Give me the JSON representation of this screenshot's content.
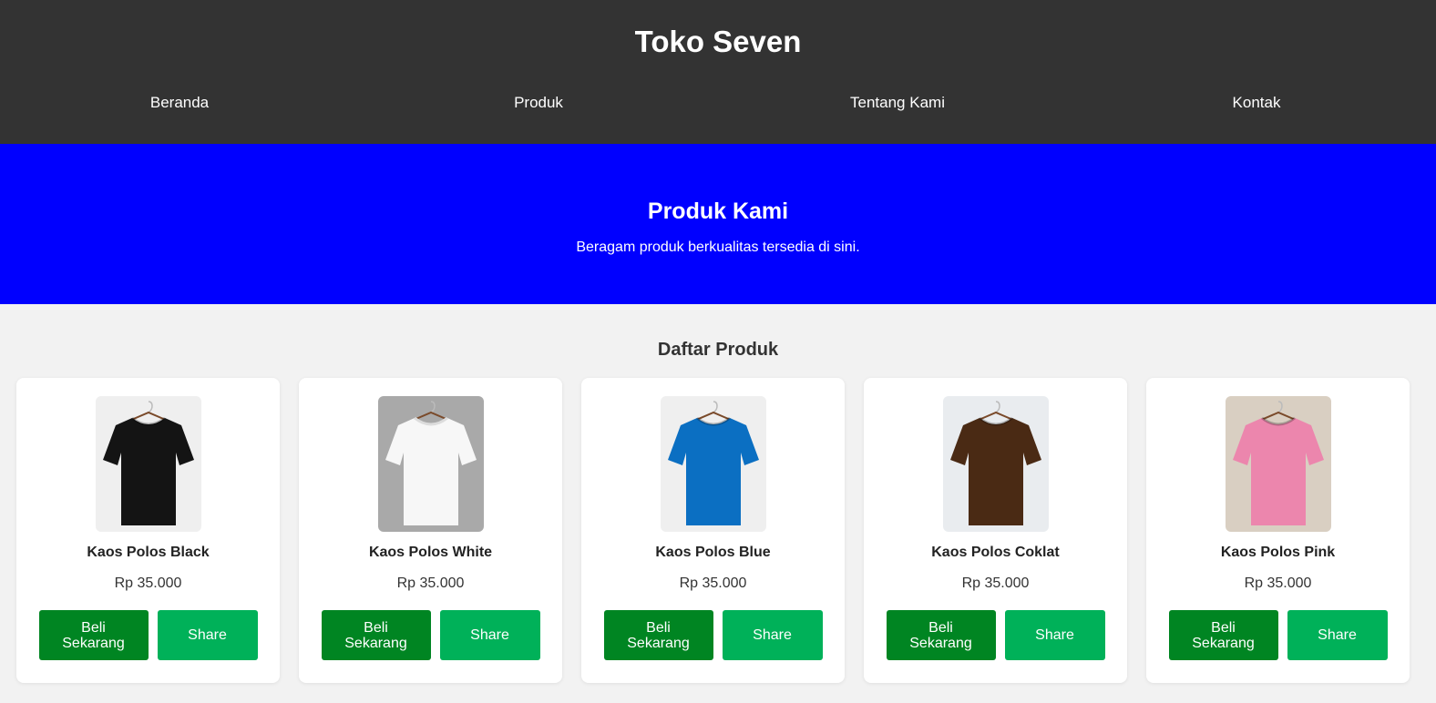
{
  "site": {
    "title": "Toko Seven"
  },
  "nav": [
    {
      "label": "Beranda"
    },
    {
      "label": "Produk"
    },
    {
      "label": "Tentang Kami"
    },
    {
      "label": "Kontak"
    }
  ],
  "hero": {
    "title": "Produk Kami",
    "subtitle": "Beragam produk berkualitas tersedia di sini."
  },
  "products_section": {
    "title": "Daftar Produk"
  },
  "products": [
    {
      "name": "Kaos Polos Black",
      "price": "Rp 35.000",
      "buy_label": "Beli Sekarang",
      "share_label": "Share",
      "shirt_color": "#141414",
      "bg_color": "#efefef"
    },
    {
      "name": "Kaos Polos White",
      "price": "Rp 35.000",
      "buy_label": "Beli Sekarang",
      "share_label": "Share",
      "shirt_color": "#f7f7f7",
      "bg_color": "#a9a9a9"
    },
    {
      "name": "Kaos Polos Blue",
      "price": "Rp 35.000",
      "buy_label": "Beli Sekarang",
      "share_label": "Share",
      "shirt_color": "#0b6fc2",
      "bg_color": "#efefef"
    },
    {
      "name": "Kaos Polos Coklat",
      "price": "Rp 35.000",
      "buy_label": "Beli Sekarang",
      "share_label": "Share",
      "shirt_color": "#4a2a14",
      "bg_color": "#e9ecef"
    },
    {
      "name": "Kaos Polos Pink",
      "price": "Rp 35.000",
      "buy_label": "Beli Sekarang",
      "share_label": "Share",
      "shirt_color": "#ec86ad",
      "bg_color": "#d9cfc2"
    }
  ],
  "colors": {
    "header_bg": "#333333",
    "hero_bg": "#0000ff",
    "buy_button": "#008522",
    "share_button": "#00b159"
  }
}
